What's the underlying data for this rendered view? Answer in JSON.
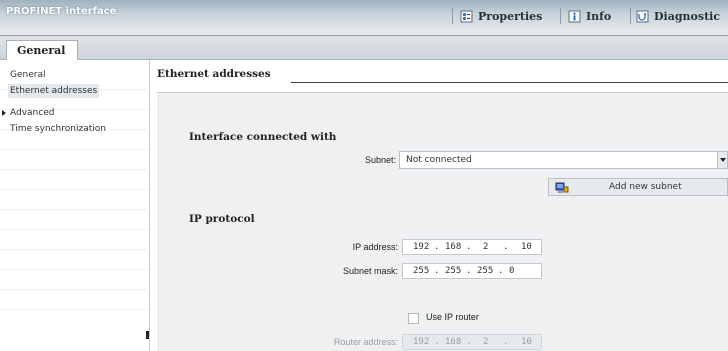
{
  "window": {
    "title": "PROFINET interface"
  },
  "top_tabs": [
    {
      "label": "Properties",
      "icon": "properties-icon"
    },
    {
      "label": "Info",
      "icon": "info-icon"
    },
    {
      "label": "Diagnostic",
      "icon": "diagnostics-icon"
    }
  ],
  "subtab": {
    "label": "General"
  },
  "sidebar": {
    "items": [
      {
        "label": "General"
      },
      {
        "label": "Ethernet addresses",
        "selected": true
      },
      {
        "label": "Advanced",
        "expandable": true
      },
      {
        "label": "Time synchronization"
      }
    ]
  },
  "content": {
    "section_title": "Ethernet addresses",
    "interface_group": {
      "title": "Interface connected with",
      "subnet_label": "Subnet:",
      "subnet_value": "Not connected",
      "add_subnet_button": "Add new subnet"
    },
    "ip_group": {
      "title": "IP protocol",
      "ip_label": "IP address:",
      "ip_octets": [
        "192",
        "168",
        "2",
        "10"
      ],
      "mask_label": "Subnet mask:",
      "mask_octets": [
        "255",
        "255",
        "255",
        "0"
      ],
      "use_router_label": "Use IP router",
      "use_router_checked": false,
      "router_label": "Router address:",
      "router_octets": [
        "192",
        "168",
        "2",
        "10"
      ]
    }
  },
  "colors": {
    "titlebar": "#9fb1bf",
    "panel": "#eef0f1",
    "selected_item": "#e3e8ec"
  }
}
